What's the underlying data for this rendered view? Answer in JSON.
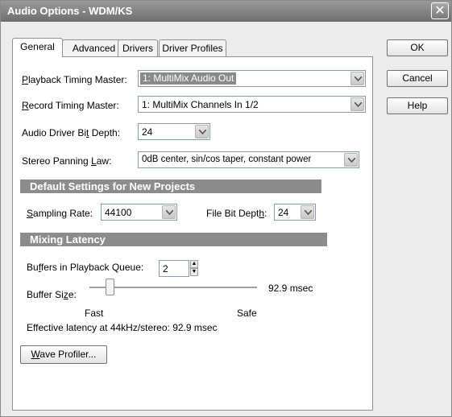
{
  "window": {
    "title": "Audio Options - WDM/KS",
    "close_glyph": "✕"
  },
  "tabs": [
    {
      "label": "General",
      "active": true
    },
    {
      "label": "Advanced",
      "active": false
    },
    {
      "label": "Drivers",
      "active": false
    },
    {
      "label": "Driver Profiles",
      "active": false
    }
  ],
  "general": {
    "playback_timing_master": {
      "label_u": "P",
      "label_rest": "layback Timing Master:",
      "value": "1: MultiMix Audio Out"
    },
    "record_timing_master": {
      "label_u": "R",
      "label_rest": "ecord Timing Master:",
      "value": "1: MultiMix Channels In 1/2"
    },
    "audio_driver_bit_depth": {
      "label_pre": "Audio Driver Bi",
      "label_u": "t",
      "label_post": " Depth:",
      "value": "24"
    },
    "stereo_panning_law": {
      "label_pre": "Stereo Panning ",
      "label_u": "L",
      "label_post": "aw:",
      "value": "0dB center, sin/cos taper, constant power"
    }
  },
  "default_settings": {
    "header": "Default Settings for New Projects",
    "sampling_rate": {
      "label_u": "S",
      "label_rest": "ampling Rate:",
      "value": "44100"
    },
    "file_bit_depth": {
      "label_pre": "File Bit Dept",
      "label_u": "h",
      "label_post": ":",
      "value": "24"
    }
  },
  "mixing_latency": {
    "header": "Mixing Latency",
    "buffers_in_queue": {
      "label_pre": "Bu",
      "label_u": "f",
      "label_post": "fers in Playback Queue:",
      "value": "2"
    },
    "buffer_size": {
      "label_pre": "Buffer Si",
      "label_u": "z",
      "label_post": "e:",
      "value_text": "92.9 msec",
      "slider_min_label": "Fast",
      "slider_max_label": "Safe",
      "slider_level": 0.1
    },
    "effective_latency": "Effective latency at 44kHz/stereo:  92.9 msec"
  },
  "wave_profiler": {
    "label_u": "W",
    "label_rest": "ave Profiler..."
  },
  "buttons": {
    "ok": "OK",
    "cancel": "Cancel",
    "help": "Help"
  }
}
